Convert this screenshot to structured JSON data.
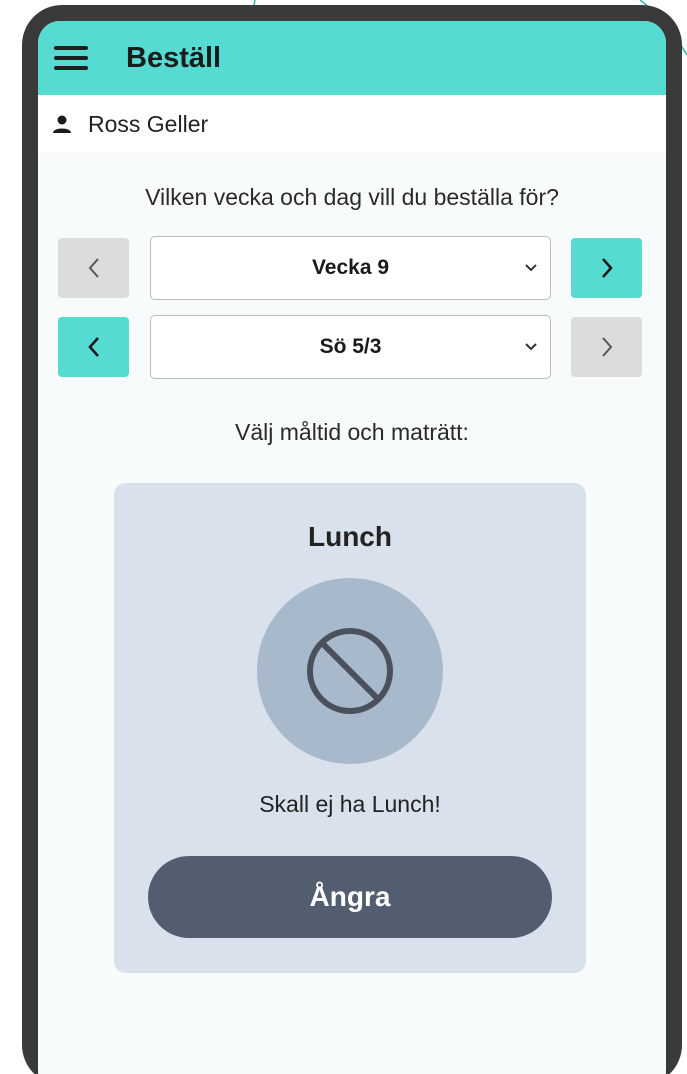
{
  "app": {
    "title": "Beställ",
    "user_name": "Ross Geller"
  },
  "question": "Vilken vecka och dag vill du beställa för?",
  "week_selector": {
    "selected": "Vecka 9",
    "prev_enabled": false,
    "next_enabled": true
  },
  "day_selector": {
    "selected": "Sö 5/3",
    "prev_enabled": true,
    "next_enabled": false
  },
  "meal_prompt": "Välj måltid och maträtt:",
  "meal_card": {
    "title": "Lunch",
    "status_icon": "ban-icon",
    "status_text": "Skall ej ha Lunch!",
    "undo_label": "Ångra"
  },
  "colors": {
    "accent": "#55dbd1",
    "disabled": "#dcdcdc",
    "card_bg": "#d8e1ec",
    "button_dark": "#535d70"
  }
}
